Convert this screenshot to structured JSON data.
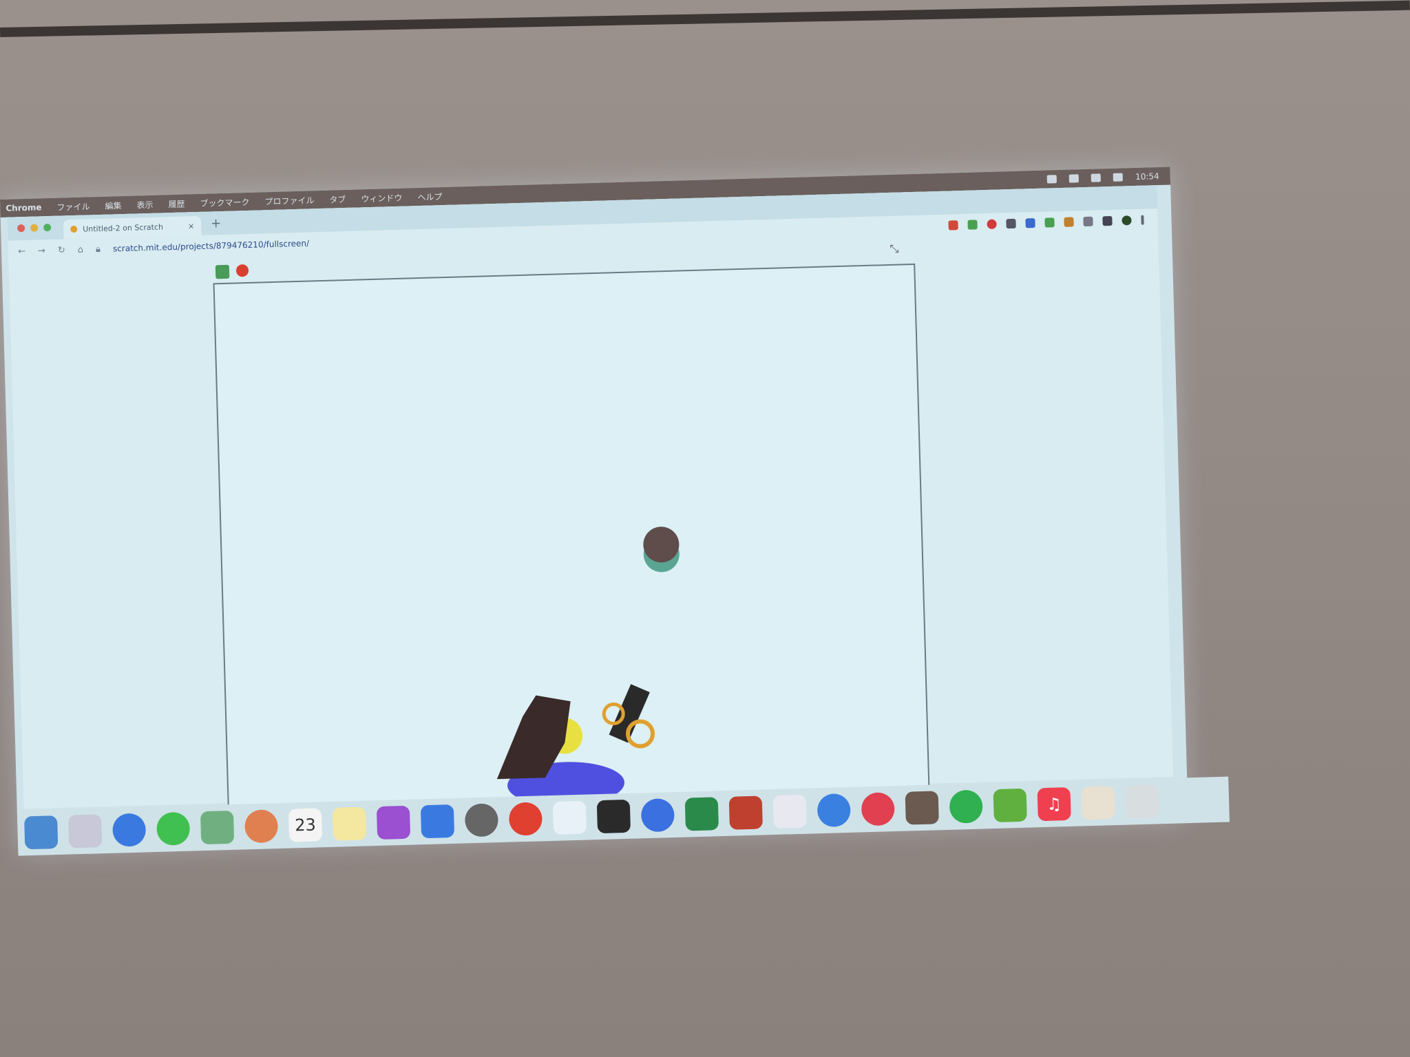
{
  "menubar": {
    "items": [
      "Chrome",
      "ファイル",
      "編集",
      "表示",
      "履歴",
      "ブックマーク",
      "プロファイル",
      "タブ",
      "ウィンドウ",
      "ヘルプ"
    ],
    "clock": "10:54"
  },
  "browser": {
    "tab_title": "Untitled-2 on Scratch",
    "new_tab": "+",
    "tab_close": "×",
    "url": "scratch.mit.edu/projects/879476210/fullscreen/"
  },
  "dock": {
    "calendar_day": "23",
    "icons": [
      "finder",
      "launchpad",
      "safari",
      "messages",
      "maps",
      "photos",
      "calendar",
      "notes",
      "podcasts",
      "app-store",
      "settings",
      "chrome",
      "vscode",
      "terminal",
      "signal",
      "excel",
      "database",
      "slack",
      "skype",
      "app",
      "app",
      "spotify",
      "numbers",
      "music",
      "preview",
      "trash"
    ]
  },
  "colors": {
    "ball": "#5e4d4b",
    "ball_shadow": "#5aa592",
    "stage": "#dcf0f5"
  }
}
